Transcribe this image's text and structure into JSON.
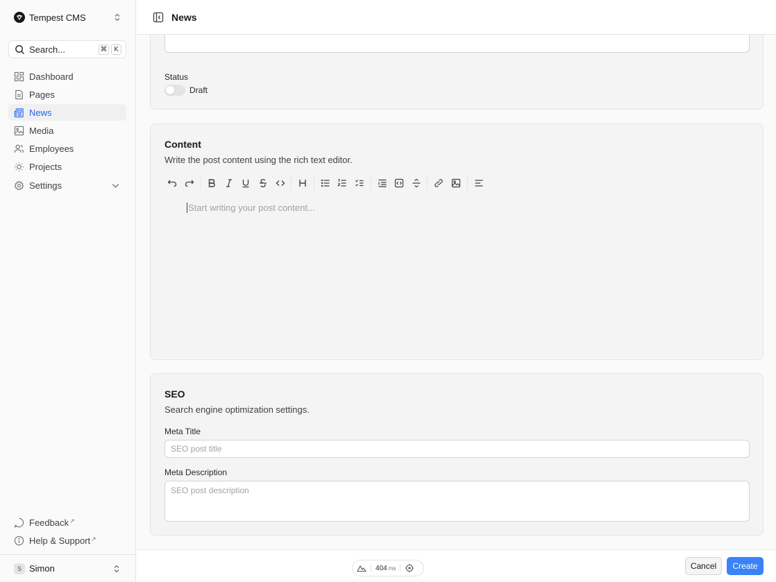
{
  "brand": {
    "name": "Tempest CMS"
  },
  "search": {
    "placeholder": "Search...",
    "shortcut_mod": "⌘",
    "shortcut_key": "K"
  },
  "nav": {
    "items": [
      {
        "label": "Dashboard",
        "icon": "dashboard-icon",
        "active": false
      },
      {
        "label": "Pages",
        "icon": "file-icon",
        "active": false
      },
      {
        "label": "News",
        "icon": "newspaper-icon",
        "active": true
      },
      {
        "label": "Media",
        "icon": "image-icon",
        "active": false
      },
      {
        "label": "Employees",
        "icon": "users-icon",
        "active": false
      },
      {
        "label": "Projects",
        "icon": "sun-icon",
        "active": false
      },
      {
        "label": "Settings",
        "icon": "gear-icon",
        "active": false
      }
    ]
  },
  "bottom_links": {
    "feedback": "Feedback",
    "help": "Help & Support"
  },
  "user": {
    "initial": "S",
    "name": "Simon"
  },
  "header": {
    "title": "News"
  },
  "status_section": {
    "label": "Status",
    "toggle_label": "Draft",
    "toggle_on": false
  },
  "content_section": {
    "title": "Content",
    "description": "Write the post content using the rich text editor.",
    "editor_placeholder": "Start writing your post content..."
  },
  "seo_section": {
    "title": "SEO",
    "description": "Search engine optimization settings.",
    "meta_title_label": "Meta Title",
    "meta_title_placeholder": "SEO post title",
    "meta_description_label": "Meta Description",
    "meta_description_placeholder": "SEO post description"
  },
  "footer": {
    "timing_value": "404",
    "timing_unit": "ms",
    "cancel_label": "Cancel",
    "create_label": "Create"
  },
  "colors": {
    "accent": "#3b82f6",
    "active_nav": "#2563eb"
  }
}
